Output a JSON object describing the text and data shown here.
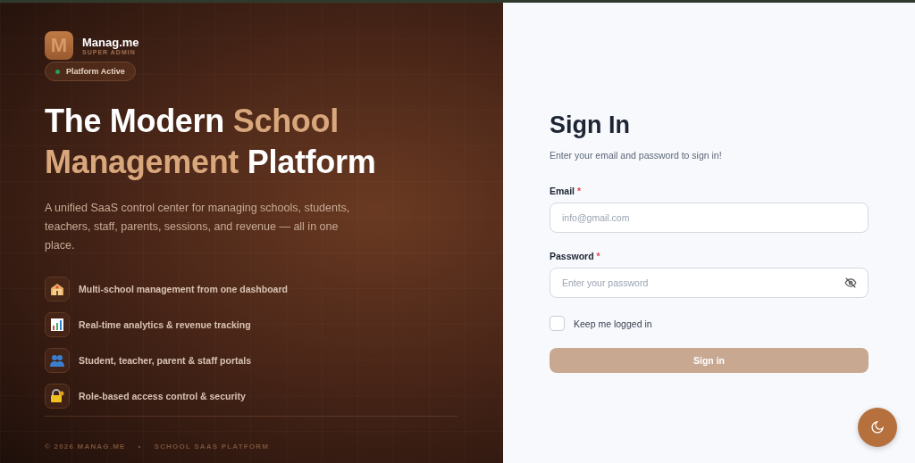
{
  "brand": {
    "logo_letter": "M",
    "name": "Manag.me",
    "role": "SUPER ADMIN"
  },
  "status_badge": {
    "label": "Platform Active",
    "color": "#22a05a"
  },
  "headline": [
    {
      "text": "The Modern ",
      "accent": false
    },
    {
      "text": "School",
      "accent": true
    },
    {
      "text": "Management",
      "accent": true
    },
    {
      "text": " Platform",
      "accent": false
    }
  ],
  "description": "A unified SaaS control center for managing schools, students, teachers, staff, parents, sessions, and revenue — all in one place.",
  "features": [
    {
      "label": "Multi-school management from one dashboard"
    },
    {
      "label": "Real-time analytics & revenue tracking"
    },
    {
      "label": "Student, teacher, parent & staff portals"
    },
    {
      "label": "Role-based access control & security"
    }
  ],
  "footer": [
    "© 2026 MANAG.ME",
    "•",
    "SCHOOL SAAS PLATFORM"
  ],
  "form": {
    "title": "Sign In",
    "subtitle": "Enter your email and password to sign in!",
    "fields": [
      {
        "label": "Email",
        "required_mark": "*",
        "placeholder": "info@gmail.com",
        "kind": "text"
      },
      {
        "label": "Password",
        "required_mark": "*",
        "placeholder": "Enter your password",
        "kind": "password"
      }
    ],
    "remember": {
      "label": "Keep me logged in",
      "checked": false
    },
    "submit": {
      "label": "Sign in",
      "disabled": true
    }
  }
}
